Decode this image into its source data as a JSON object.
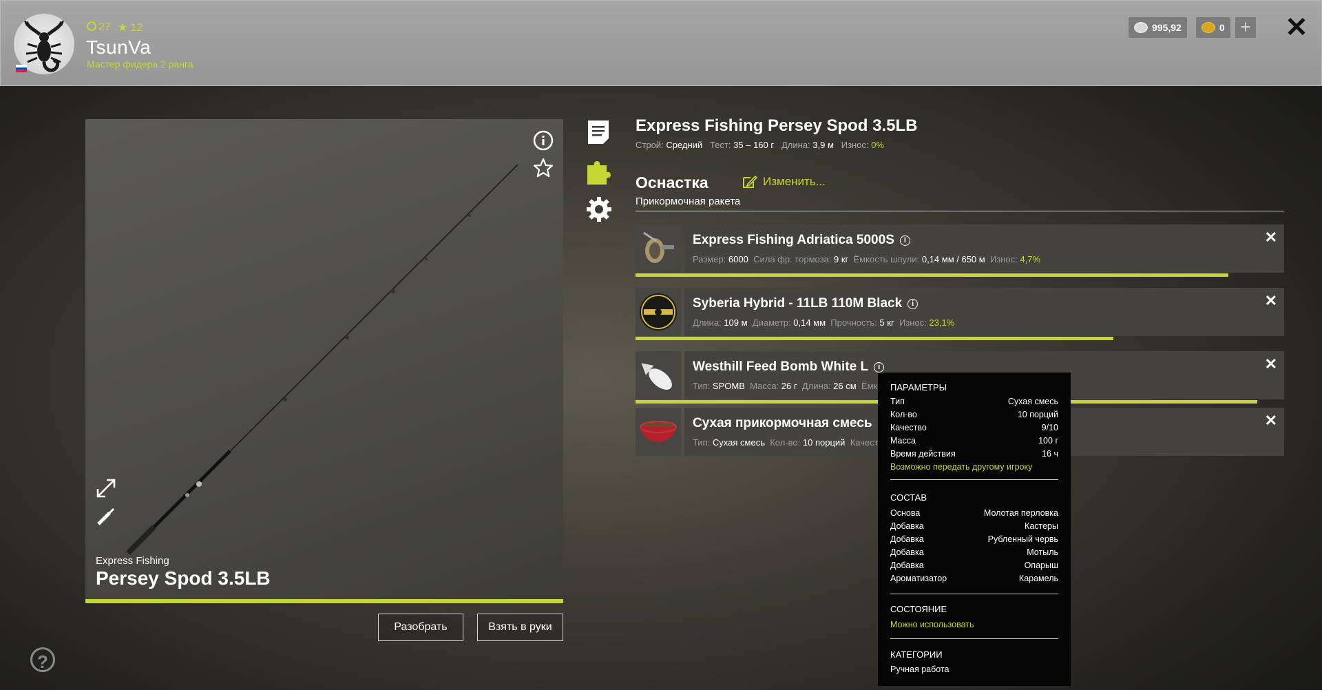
{
  "header": {
    "level": "27",
    "stars": "12",
    "username": "TsunVa",
    "rank": "Мастер фидера 2 ранга",
    "silver": "995,92",
    "gold": "0",
    "add_label": "+",
    "close_label": "✕"
  },
  "rod": {
    "brand": "Express Fishing",
    "name": "Persey Spod 3.5LB",
    "disassemble_label": "Разобрать",
    "take_label": "Взять в руки",
    "help_label": "?"
  },
  "details": {
    "title": "Express Fishing Persey Spod 3.5LB",
    "props": [
      {
        "label": "Строй:",
        "value": "Средний"
      },
      {
        "label": "Тест:",
        "value": "35 – 160 г"
      },
      {
        "label": "Длина:",
        "value": "3,9 м"
      },
      {
        "label": "Износ:",
        "value": "0%"
      }
    ],
    "section_title": "Оснастка",
    "edit_label": "Изменить...",
    "rig_type": "Прикормочная ракета"
  },
  "equipment": [
    {
      "name": "Express Fishing Adriatica 5000S",
      "props": [
        {
          "label": "Размер:",
          "value": "6000"
        },
        {
          "label": "Сила фр. тормоза:",
          "value": "9 кг"
        },
        {
          "label": "Ёмкость шпули:",
          "value": "0,14 мм / 650 м"
        },
        {
          "label": "Износ:",
          "value": "4,7%"
        }
      ],
      "wear_remaining": 0.953
    },
    {
      "name": "Syberia Hybrid - 11LB 110M Black",
      "props": [
        {
          "label": "Длина:",
          "value": "109 м"
        },
        {
          "label": "Диаметр:",
          "value": "0,14 мм"
        },
        {
          "label": "Прочность:",
          "value": "5 кг"
        },
        {
          "label": "Износ:",
          "value": "23,1%"
        }
      ],
      "wear_remaining": 0.769
    },
    {
      "name": "Westhill Feed Bomb White L",
      "props": [
        {
          "label": "Тип:",
          "value": "SPOMB"
        },
        {
          "label": "Масса:",
          "value": "26 г"
        },
        {
          "label": "Длина:",
          "value": "26 см"
        },
        {
          "label": "Ёмкос",
          "value": ""
        }
      ],
      "wear_remaining": 1.0
    },
    {
      "name": "Сухая прикормочная смесь",
      "props": [
        {
          "label": "Тип:",
          "value": "Сухая смесь"
        },
        {
          "label": "Кол-во:",
          "value": "10 порций"
        },
        {
          "label": "Качест",
          "value": ""
        }
      ]
    }
  ],
  "tooltip": {
    "params_title": "ПАРАМЕТРЫ",
    "params": [
      {
        "label": "Тип",
        "value": "Сухая смесь"
      },
      {
        "label": "Кол-во",
        "value": "10 порций"
      },
      {
        "label": "Качество",
        "value": "9/10"
      },
      {
        "label": "Масса",
        "value": "100 г"
      },
      {
        "label": "Время действия",
        "value": "16 ч"
      }
    ],
    "transferable": "Возможно передать другому игроку",
    "composition_title": "СОСТАВ",
    "composition": [
      {
        "label": "Основа",
        "value": "Молотая перловка"
      },
      {
        "label": "Добавка",
        "value": "Кастеры"
      },
      {
        "label": "Добавка",
        "value": "Рубленный червь"
      },
      {
        "label": "Добавка",
        "value": "Мотыль"
      },
      {
        "label": "Добавка",
        "value": "Опарыш"
      },
      {
        "label": "Ароматизатор",
        "value": "Карамель"
      }
    ],
    "state_title": "СОСТОЯНИЕ",
    "state_value": "Можно использовать",
    "categories_title": "КАТЕГОРИИ",
    "categories_value": "Ручная работа"
  },
  "colors": {
    "accent": "#c6d633",
    "topbar": "#a0a0a0",
    "tooltip_bg": "#050505"
  }
}
